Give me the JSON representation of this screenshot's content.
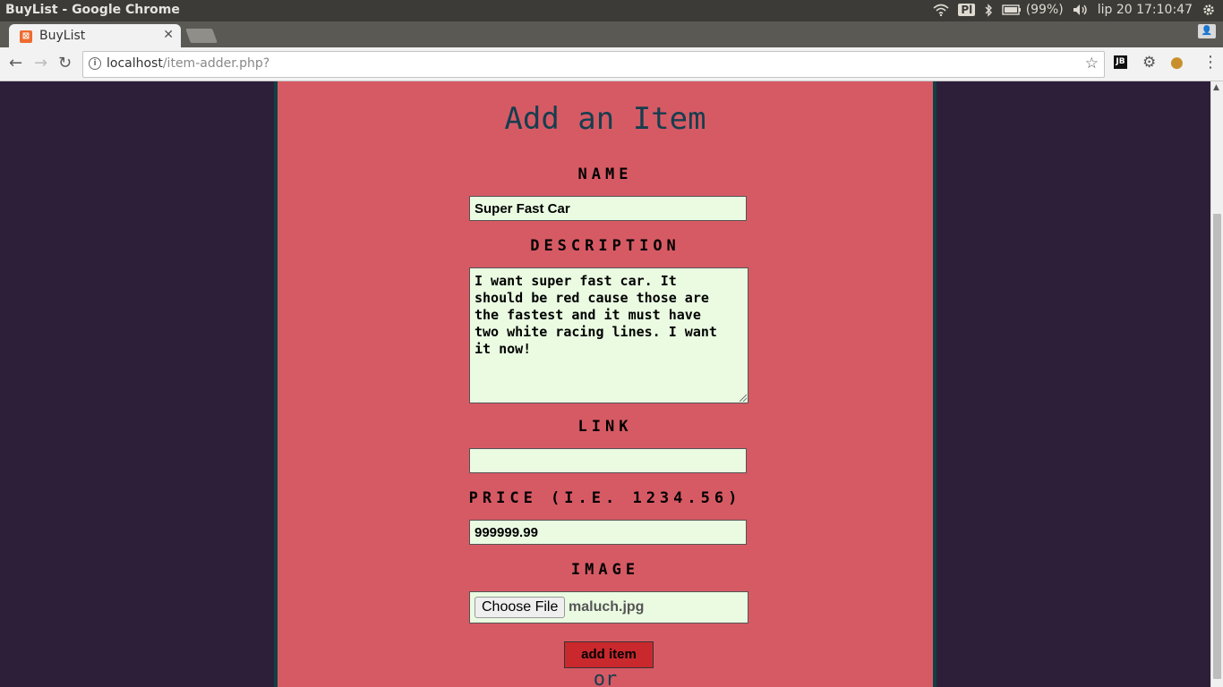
{
  "os": {
    "window_title": "BuyList - Google Chrome",
    "keyboard_layout": "Pl",
    "battery": "(99%)",
    "datetime": "lip 20 17:10:47"
  },
  "browser": {
    "tab_label": "BuyList",
    "url_host": "localhost",
    "url_path": "/item-adder.php?",
    "extension_jb": "JB"
  },
  "page": {
    "title": "Add an Item",
    "labels": {
      "name": "NAME",
      "description": "DESCRIPTION",
      "link": "LINK",
      "price": "PRICE (I.E. 1234.56)",
      "image": "IMAGE"
    },
    "values": {
      "name": "Super Fast Car",
      "description": "I want super fast car. It\nshould be red cause those are\nthe fastest and it must have\ntwo white racing lines. I want\nit now!",
      "link": "",
      "price": "999999.99",
      "file_name": "maluch.jpg"
    },
    "choose_file_label": "Choose File",
    "add_button_label": "add item",
    "or_text": "or"
  }
}
